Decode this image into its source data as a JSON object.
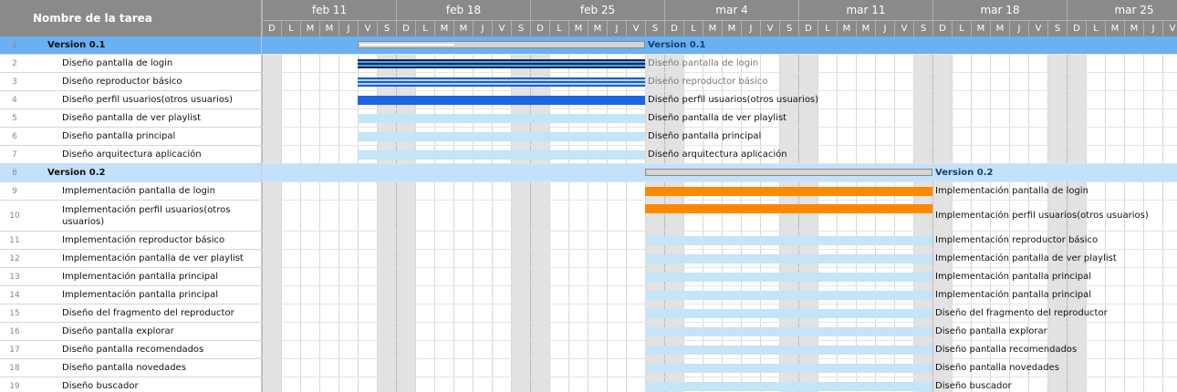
{
  "header": {
    "task_column": "Nombre de la tarea",
    "weeks": [
      "feb 11",
      "feb 18",
      "feb 25",
      "mar 4",
      "mar 11",
      "mar 18",
      "mar 25"
    ],
    "day_letters": [
      "D",
      "L",
      "M",
      "M",
      "J",
      "V",
      "S"
    ]
  },
  "colors": {
    "version_01": "#6ab0f3",
    "version_02": "#c4e1fb",
    "bar_pale_blue": "#c4e4f7",
    "bar_orange": "#ff8800",
    "bar_royal_blue": "#1e66e0",
    "bar_navy": "#0f2a55",
    "weekend": "#e2e2e2"
  },
  "gantt": {
    "date_range": [
      "2013-02-10",
      "2013-03-30"
    ],
    "tasks": [
      {
        "num": "1",
        "name": "Version 0.1",
        "type": "group",
        "start": "2013-02-15",
        "end": "2013-03-01",
        "style": "summary",
        "bar_label": "Version 0.1",
        "progress": 0.33
      },
      {
        "num": "2",
        "name": "Diseño pantalla de login",
        "type": "task",
        "start": "2013-02-15",
        "end": "2013-03-01",
        "style": "navy",
        "bar_label": "Diseño pantalla de login",
        "dim": true
      },
      {
        "num": "3",
        "name": "Diseño reproductor básico",
        "type": "task",
        "start": "2013-02-15",
        "end": "2013-03-01",
        "style": "striped",
        "bar_label": "Diseño reproductor básico",
        "dim": true
      },
      {
        "num": "4",
        "name": "Diseño perfil usuarios(otros usuarios)",
        "type": "task",
        "start": "2013-02-15",
        "end": "2013-03-01",
        "style": "royal",
        "bar_label": "Diseño perfil usuarios(otros usuarios)"
      },
      {
        "num": "5",
        "name": "Diseño pantalla de ver playlist",
        "type": "task",
        "start": "2013-02-15",
        "end": "2013-03-01",
        "style": "pale",
        "bar_label": "Diseño pantalla de ver playlist"
      },
      {
        "num": "6",
        "name": "Diseño pantalla principal",
        "type": "task",
        "start": "2013-02-15",
        "end": "2013-03-01",
        "style": "pale",
        "bar_label": "Diseño pantalla principal"
      },
      {
        "num": "7",
        "name": "Diseño arquitectura aplicación",
        "type": "task",
        "start": "2013-02-15",
        "end": "2013-03-01",
        "style": "pale",
        "bar_label": "Diseño arquitectura aplicación"
      },
      {
        "num": "8",
        "name": "Version 0.2",
        "type": "group",
        "start": "2013-03-02",
        "end": "2013-03-16",
        "style": "summary",
        "bar_label": "Version 0.2",
        "progress": 0
      },
      {
        "num": "9",
        "name": "Implementación pantalla de login",
        "type": "task",
        "start": "2013-03-02",
        "end": "2013-03-16",
        "style": "orange",
        "bar_label": "Implementación pantalla de login"
      },
      {
        "num": "10",
        "name": "Implementación perfil usuarios(otros usuarios)",
        "type": "task",
        "start": "2013-03-02",
        "end": "2013-03-16",
        "style": "orange",
        "bar_label": "Implementación perfil usuarios(otros usuarios)",
        "tall": true
      },
      {
        "num": "11",
        "name": "Implementación reproductor básico",
        "type": "task",
        "start": "2013-03-02",
        "end": "2013-03-16",
        "style": "pale",
        "bar_label": "Implementación reproductor básico"
      },
      {
        "num": "12",
        "name": "Implementación pantalla de ver playlist",
        "type": "task",
        "start": "2013-03-02",
        "end": "2013-03-16",
        "style": "pale",
        "bar_label": "Implementación pantalla de ver playlist"
      },
      {
        "num": "13",
        "name": "Implementación pantalla principal",
        "type": "task",
        "start": "2013-03-02",
        "end": "2013-03-16",
        "style": "pale",
        "bar_label": "Implementación pantalla principal"
      },
      {
        "num": "14",
        "name": "Implementación pantalla principal",
        "type": "task",
        "start": "2013-03-02",
        "end": "2013-03-16",
        "style": "pale",
        "bar_label": "Implementación pantalla principal"
      },
      {
        "num": "15",
        "name": "Diseño del fragmento del reproductor",
        "type": "task",
        "start": "2013-03-02",
        "end": "2013-03-16",
        "style": "pale",
        "bar_label": "Diseño del fragmento del reproductor"
      },
      {
        "num": "16",
        "name": "Diseño pantalla explorar",
        "type": "task",
        "start": "2013-03-02",
        "end": "2013-03-16",
        "style": "pale",
        "bar_label": "Diseño pantalla explorar"
      },
      {
        "num": "17",
        "name": "Diseño pantalla recomendados",
        "type": "task",
        "start": "2013-03-02",
        "end": "2013-03-16",
        "style": "pale",
        "bar_label": "Diseño pantalla recomendados"
      },
      {
        "num": "18",
        "name": "Diseño pantalla novedades",
        "type": "task",
        "start": "2013-03-02",
        "end": "2013-03-16",
        "style": "pale",
        "bar_label": "Diseño pantalla novedades"
      },
      {
        "num": "19",
        "name": "Diseño buscador",
        "type": "task",
        "start": "2013-03-02",
        "end": "2013-03-16",
        "style": "pale",
        "bar_label": "Diseño buscador"
      }
    ]
  }
}
